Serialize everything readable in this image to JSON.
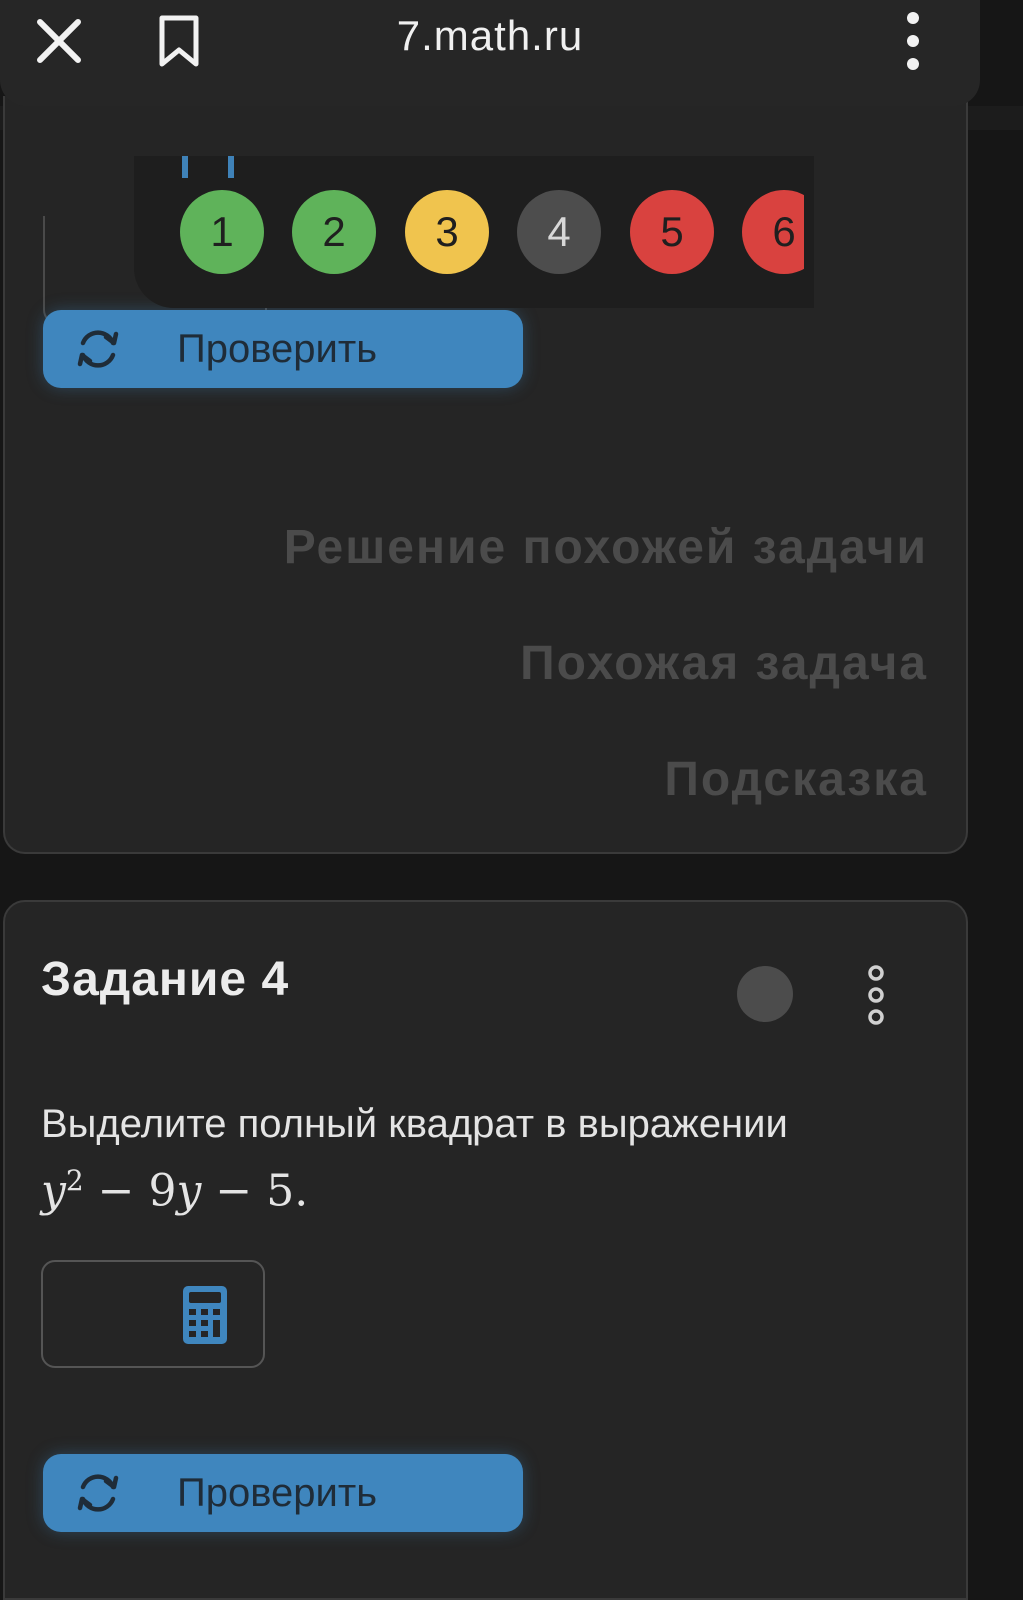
{
  "browser": {
    "url": "7.math.ru"
  },
  "colors": {
    "score_green": "#5fb35a",
    "score_yellow": "#f0c44e",
    "score_gray": "#4d4d4d",
    "score_red": "#d9423f",
    "accent_blue": "#3f86be"
  },
  "score_bar": {
    "items": [
      {
        "label": "1",
        "status": "correct"
      },
      {
        "label": "2",
        "status": "correct"
      },
      {
        "label": "3",
        "status": "partial"
      },
      {
        "label": "4",
        "status": "unanswered"
      },
      {
        "label": "5",
        "status": "wrong"
      },
      {
        "label": "6",
        "status": "wrong"
      }
    ]
  },
  "previous_task": {
    "check_label": "Проверить",
    "links": {
      "similar_solution": "Решение похожей задачи",
      "similar_task": "Похожая задача",
      "hint": "Подсказка"
    }
  },
  "task4": {
    "title": "Задание 4",
    "text": "Выделите полный квадрат в выражении",
    "formula": {
      "var1": "y",
      "exp": "2",
      "op1": " − 9",
      "var2": "y",
      "op2": " − 5."
    },
    "check_label": "Проверить"
  },
  "icons": {
    "close": "close-icon",
    "bookmark": "bookmark-icon",
    "more": "more-vertical-icon",
    "refresh": "refresh-icon",
    "calculator": "calculator-icon"
  }
}
